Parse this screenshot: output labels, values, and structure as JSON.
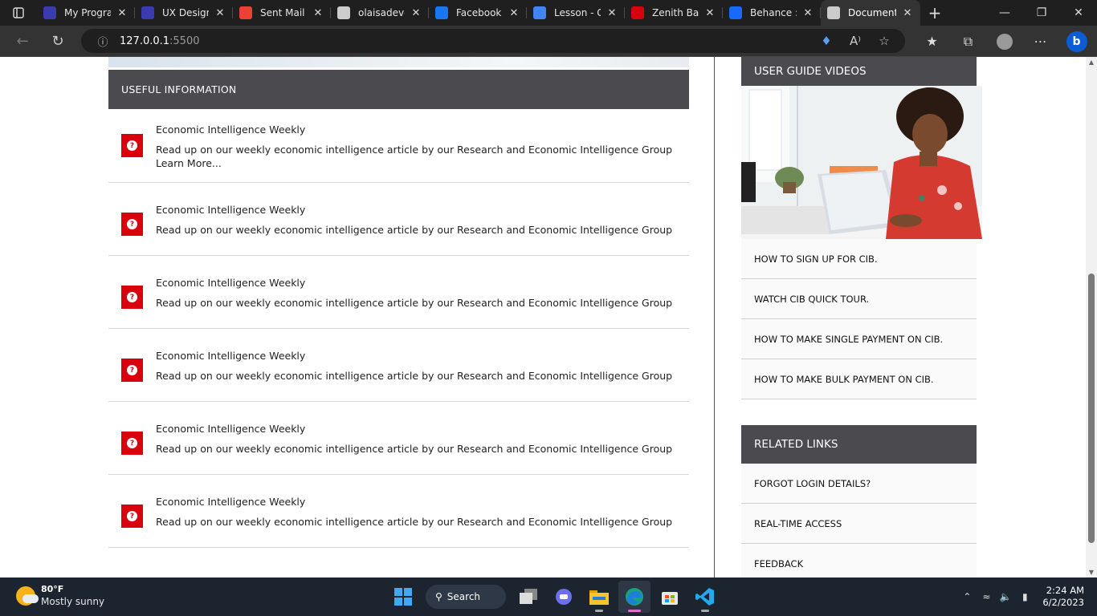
{
  "browser": {
    "tabs": [
      {
        "title": "My Program",
        "icon": "program-icon",
        "color": "#3b3bb0"
      },
      {
        "title": "UX Design",
        "icon": "program-icon",
        "color": "#3b3bb0"
      },
      {
        "title": "Sent Mail -",
        "icon": "gmail-icon",
        "color": "#ea4335"
      },
      {
        "title": "olaisadevel",
        "icon": "github-icon",
        "color": "#cccccc"
      },
      {
        "title": "Facebook",
        "icon": "facebook-icon",
        "color": "#1877f2"
      },
      {
        "title": "Lesson - Go",
        "icon": "google-icon",
        "color": "#4285f4"
      },
      {
        "title": "Zenith Bank",
        "icon": "zenith-icon",
        "color": "#d9000d"
      },
      {
        "title": "Behance ::",
        "icon": "behance-icon",
        "color": "#1769ff"
      },
      {
        "title": "Document",
        "icon": "document-icon",
        "color": "#cccccc"
      }
    ],
    "url_host": "127.0.0.1",
    "url_port": ":5500"
  },
  "useful": {
    "heading": "USEFUL INFORMATION",
    "items": [
      {
        "title": "Economic Intelligence Weekly",
        "desc": "Read up on our weekly economic intelligence article by our Research and Economic Intelligence Group Learn More..."
      },
      {
        "title": "Economic Intelligence Weekly",
        "desc": "Read up on our weekly economic intelligence article by our Research and Economic Intelligence Group"
      },
      {
        "title": "Economic Intelligence Weekly",
        "desc": "Read up on our weekly economic intelligence article by our Research and Economic Intelligence Group"
      },
      {
        "title": "Economic Intelligence Weekly",
        "desc": "Read up on our weekly economic intelligence article by our Research and Economic Intelligence Group"
      },
      {
        "title": "Economic Intelligence Weekly",
        "desc": "Read up on our weekly economic intelligence article by our Research and Economic Intelligence Group"
      },
      {
        "title": "Economic Intelligence Weekly",
        "desc": "Read up on our weekly economic intelligence article by our Research and Economic Intelligence Group"
      }
    ],
    "icon": "question-icon",
    "icon_color": "#d9000d"
  },
  "sidebar": {
    "videos_heading": "USER GUIDE VIDEOS",
    "video_links": [
      "HOW TO SIGN UP FOR CIB.",
      "WATCH CIB QUICK TOUR.",
      "HOW TO MAKE SINGLE PAYMENT ON CIB.",
      "HOW TO MAKE BULK PAYMENT ON CIB."
    ],
    "related_heading": "RELATED LINKS",
    "related_links": [
      "FORGOT LOGIN DETAILS?",
      "REAL-TIME ACCESS",
      "FEEDBACK"
    ]
  },
  "taskbar": {
    "temperature": "80°F",
    "condition": "Mostly sunny",
    "search_label": "Search",
    "time": "2:24 AM",
    "date": "6/2/2023"
  }
}
